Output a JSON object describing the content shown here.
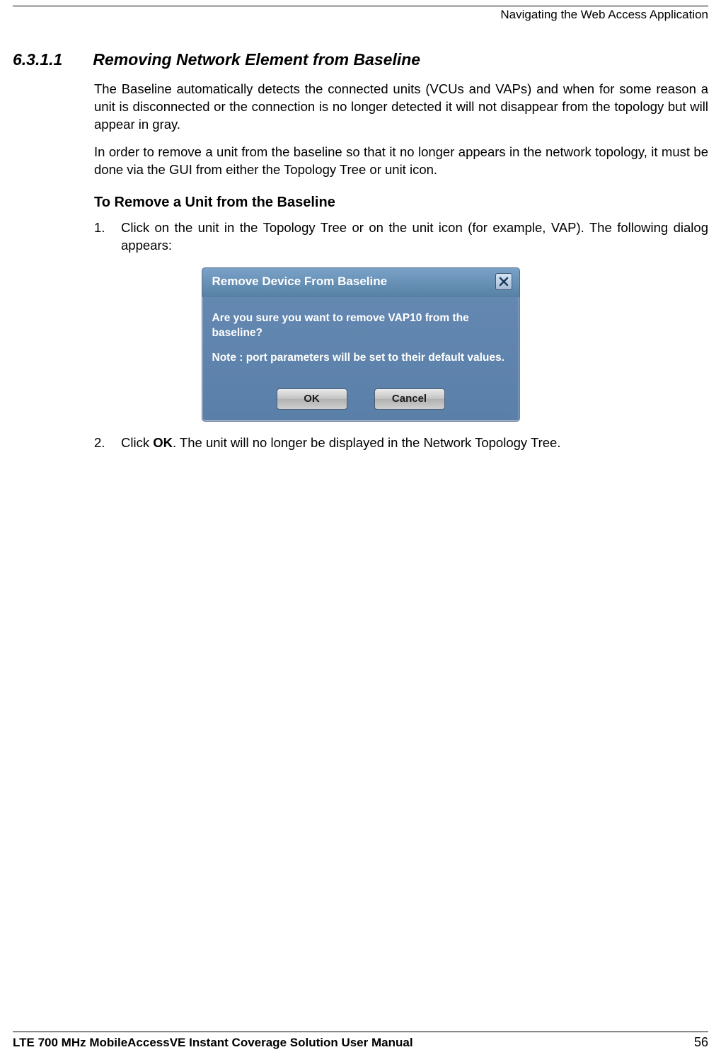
{
  "header": {
    "right_text": "Navigating the Web Access Application"
  },
  "section": {
    "number": "6.3.1.1",
    "title": "Removing Network Element from Baseline",
    "para1": "The Baseline automatically detects the connected units (VCUs and VAPs) and when for some reason a unit is disconnected or the connection is no longer detected it will not disappear from the topology but will appear in gray.",
    "para2": "In order to remove a unit from the baseline so that it no longer appears in the network topology, it must be done via the GUI from either the Topology Tree or unit icon.",
    "subheading": "To Remove a Unit from the Baseline",
    "step1_num": "1.",
    "step1_text": "Click on the unit in the Topology Tree or on the unit icon (for example, VAP). The following dialog appears:",
    "step2_num": "2.",
    "step2_prefix": "Click ",
    "step2_bold": "OK",
    "step2_suffix": ". The unit will no longer be displayed in the Network Topology Tree."
  },
  "dialog": {
    "title": "Remove Device From Baseline",
    "message1": "Are you sure you want to remove VAP10 from the baseline?",
    "message2": "Note : port parameters will be set to their default values.",
    "ok_label": "OK",
    "cancel_label": "Cancel"
  },
  "footer": {
    "title": "LTE 700 MHz MobileAccessVE Instant Coverage Solution User Manual",
    "page": "56"
  }
}
